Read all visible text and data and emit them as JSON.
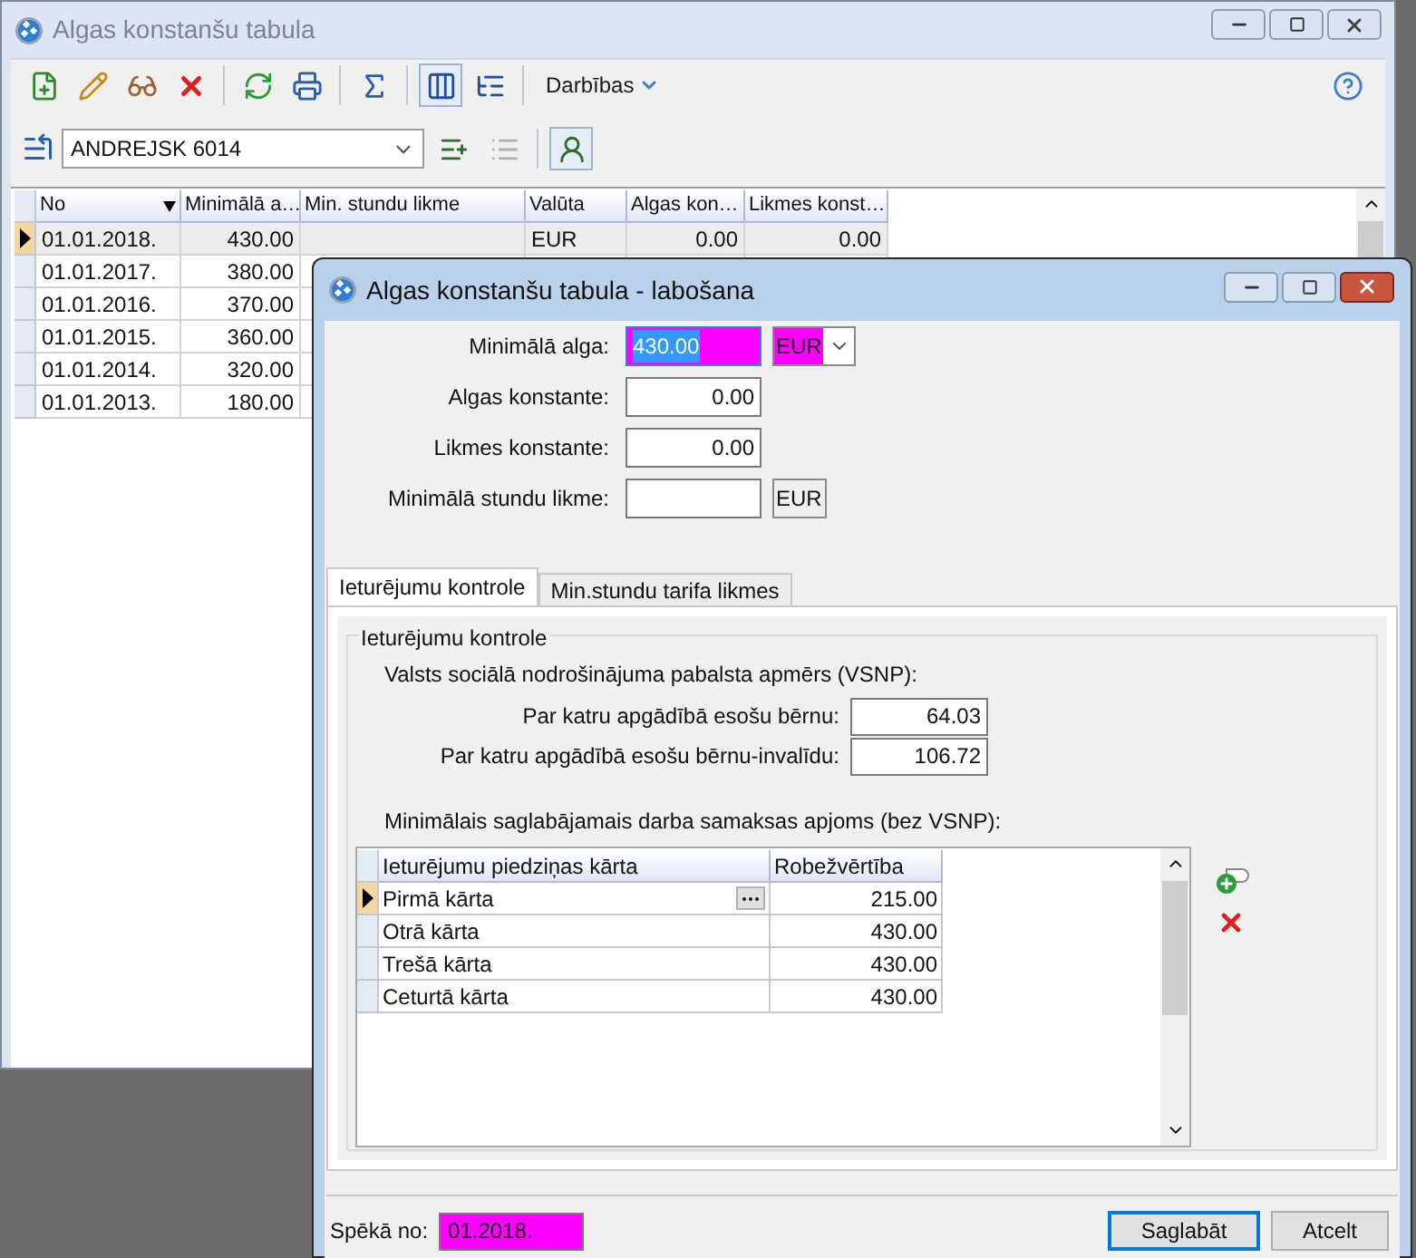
{
  "main_window": {
    "title": "Algas konstanšu tabula",
    "toolbar": {
      "buttons": [
        {
          "pressed": false
        },
        {
          "pressed": false
        },
        {
          "pressed": false
        },
        {
          "pressed": false
        },
        {
          "pressed": false
        },
        {
          "pressed": false
        },
        {
          "pressed": false
        },
        {
          "pressed": true
        },
        {
          "pressed": false
        }
      ],
      "menu_label": "Darbības"
    },
    "filter_bar": {
      "employee": "ANDREJSK 6014",
      "buttons": [
        {
          "pressed": false,
          "disabled": false
        },
        {
          "pressed": false,
          "disabled": true
        },
        {
          "pressed": true,
          "disabled": false
        }
      ]
    },
    "table": {
      "columns": [
        "No",
        "Minimālā a…",
        "Min. stundu likme",
        "Valūta",
        "Algas kon…",
        "Likmes konst…"
      ],
      "rows": [
        {
          "selected": true,
          "no": "01.01.2018.",
          "min_alga": "430.00",
          "valuta": "EUR",
          "algas_konstante": "0.00",
          "likmes_konstante": "0.00"
        },
        {
          "selected": false,
          "no": "01.01.2017.",
          "min_alga": "380.00"
        },
        {
          "selected": false,
          "no": "01.01.2016.",
          "min_alga": "370.00"
        },
        {
          "selected": false,
          "no": "01.01.2015.",
          "min_alga": "360.00"
        },
        {
          "selected": false,
          "no": "01.01.2014.",
          "min_alga": "320.00"
        },
        {
          "selected": false,
          "no": "01.01.2013.",
          "min_alga": "180.00"
        }
      ]
    }
  },
  "dialog": {
    "title": "Algas konstanšu tabula - labošana",
    "fields": [
      {
        "label": "Minimālā alga:",
        "value": "430.00",
        "highlighted": true,
        "text_selected": true,
        "currency": {
          "kind": "dropdown",
          "value": "EUR",
          "highlighted": true
        }
      },
      {
        "label": "Algas konstante:",
        "value": "0.00",
        "highlighted": false,
        "text_selected": false
      },
      {
        "label": "Likmes konstante:",
        "value": "0.00",
        "highlighted": false,
        "text_selected": false
      },
      {
        "label": "Minimālā stundu likme:",
        "highlighted": false,
        "currency": {
          "kind": "box",
          "value": "EUR",
          "highlighted": false
        }
      }
    ],
    "tabs": [
      {
        "label": "Ieturējumu kontrole",
        "selected": true
      },
      {
        "label": "Min.stundu tarifa likmes",
        "selected": false
      }
    ],
    "group": {
      "title": "Ieturējumu kontrole",
      "vsnp_label": "Valsts sociālā nodrošinājuma pabalsta apmērs (VSNP):",
      "vsnp_fields": [
        {
          "label": "Par katru apgādībā esošu bērnu:",
          "value": "64.03"
        },
        {
          "label": "Par katru apgādībā esošu bērnu-invalīdu:",
          "value": "106.72"
        }
      ],
      "minimum_label": "Minimālais saglabājamais darba samaksas apjoms (bez VSNP):",
      "table": {
        "columns": [
          "Ieturējumu piedziņas kārta",
          "Robežvērtība"
        ],
        "rows": [
          {
            "selected": true,
            "cells": [
              "Pirmā kārta",
              "215.00"
            ]
          },
          {
            "selected": false,
            "cells": [
              "Otrā kārta",
              "430.00"
            ]
          },
          {
            "selected": false,
            "cells": [
              "Trešā kārta",
              "430.00"
            ]
          },
          {
            "selected": false,
            "cells": [
              "Ceturtā kārta",
              "430.00"
            ]
          }
        ]
      }
    },
    "effective_from": {
      "label": "Spēkā no:",
      "value": "01.2018.",
      "highlighted": true
    },
    "buttons": [
      {
        "label": "Saglabāt",
        "default": true
      },
      {
        "label": "Atcelt",
        "default": false
      }
    ]
  }
}
